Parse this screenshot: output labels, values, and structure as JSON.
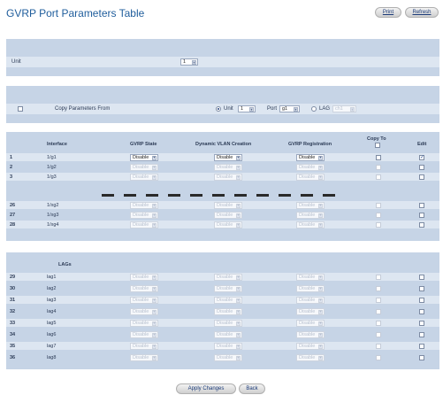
{
  "page": {
    "title": "GVRP Port Parameters Table",
    "print_label": "Print",
    "refresh_label": "Refresh"
  },
  "unit_panel": {
    "label": "Unit",
    "unit_value": "1"
  },
  "copy_panel": {
    "label": "Copy Parameters From",
    "unit_radio_label": "Unit",
    "unit_value": "1",
    "port_label": "Port",
    "port_value": "g1",
    "lag_radio_label": "LAG",
    "lag_value": "ch1"
  },
  "table": {
    "headers": {
      "interface": "Interface",
      "gvrp_state": "GVRP State",
      "dynamic_vlan": "Dynamic VLAN Creation",
      "gvrp_registration": "GVRP Registration",
      "copy_to": "Copy To",
      "edit": "Edit"
    },
    "option_value": "Disable",
    "rows_top": [
      {
        "num": "1",
        "iface": "1/g1",
        "enabled": true,
        "edit_checked": true
      },
      {
        "num": "2",
        "iface": "1/g2",
        "enabled": false,
        "edit_checked": false
      },
      {
        "num": "3",
        "iface": "1/g3",
        "enabled": false,
        "edit_checked": false
      }
    ],
    "rows_mid": [
      {
        "num": "26",
        "iface": "1/xg2"
      },
      {
        "num": "27",
        "iface": "1/xg3"
      },
      {
        "num": "28",
        "iface": "1/xg4"
      }
    ]
  },
  "lags": {
    "header": "LAGs",
    "rows": [
      {
        "num": "29",
        "iface": "lag1"
      },
      {
        "num": "30",
        "iface": "lag2"
      },
      {
        "num": "31",
        "iface": "lag3"
      },
      {
        "num": "32",
        "iface": "lag4"
      },
      {
        "num": "33",
        "iface": "lag5"
      },
      {
        "num": "34",
        "iface": "lag6"
      },
      {
        "num": "35",
        "iface": "lag7"
      },
      {
        "num": "36",
        "iface": "lag8"
      }
    ]
  },
  "footer": {
    "apply_label": "Apply Changes",
    "back_label": "Back"
  }
}
